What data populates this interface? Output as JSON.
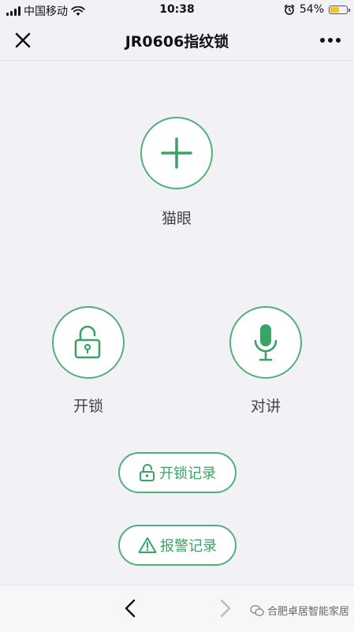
{
  "status": {
    "carrier": "中国移动",
    "time": "10:38",
    "battery": "54%",
    "battery_level": 0.54
  },
  "nav": {
    "title": "JR0606指纹锁"
  },
  "actions": {
    "peephole": "猫眼",
    "unlock": "开锁",
    "intercom": "对讲"
  },
  "records": {
    "unlock_record": "开锁记录",
    "alarm_record": "报警记录"
  },
  "footer": {
    "watermark": "合肥卓居智能家居"
  },
  "colors": {
    "accent": "#4fb07a",
    "battery": "#f6c800"
  }
}
